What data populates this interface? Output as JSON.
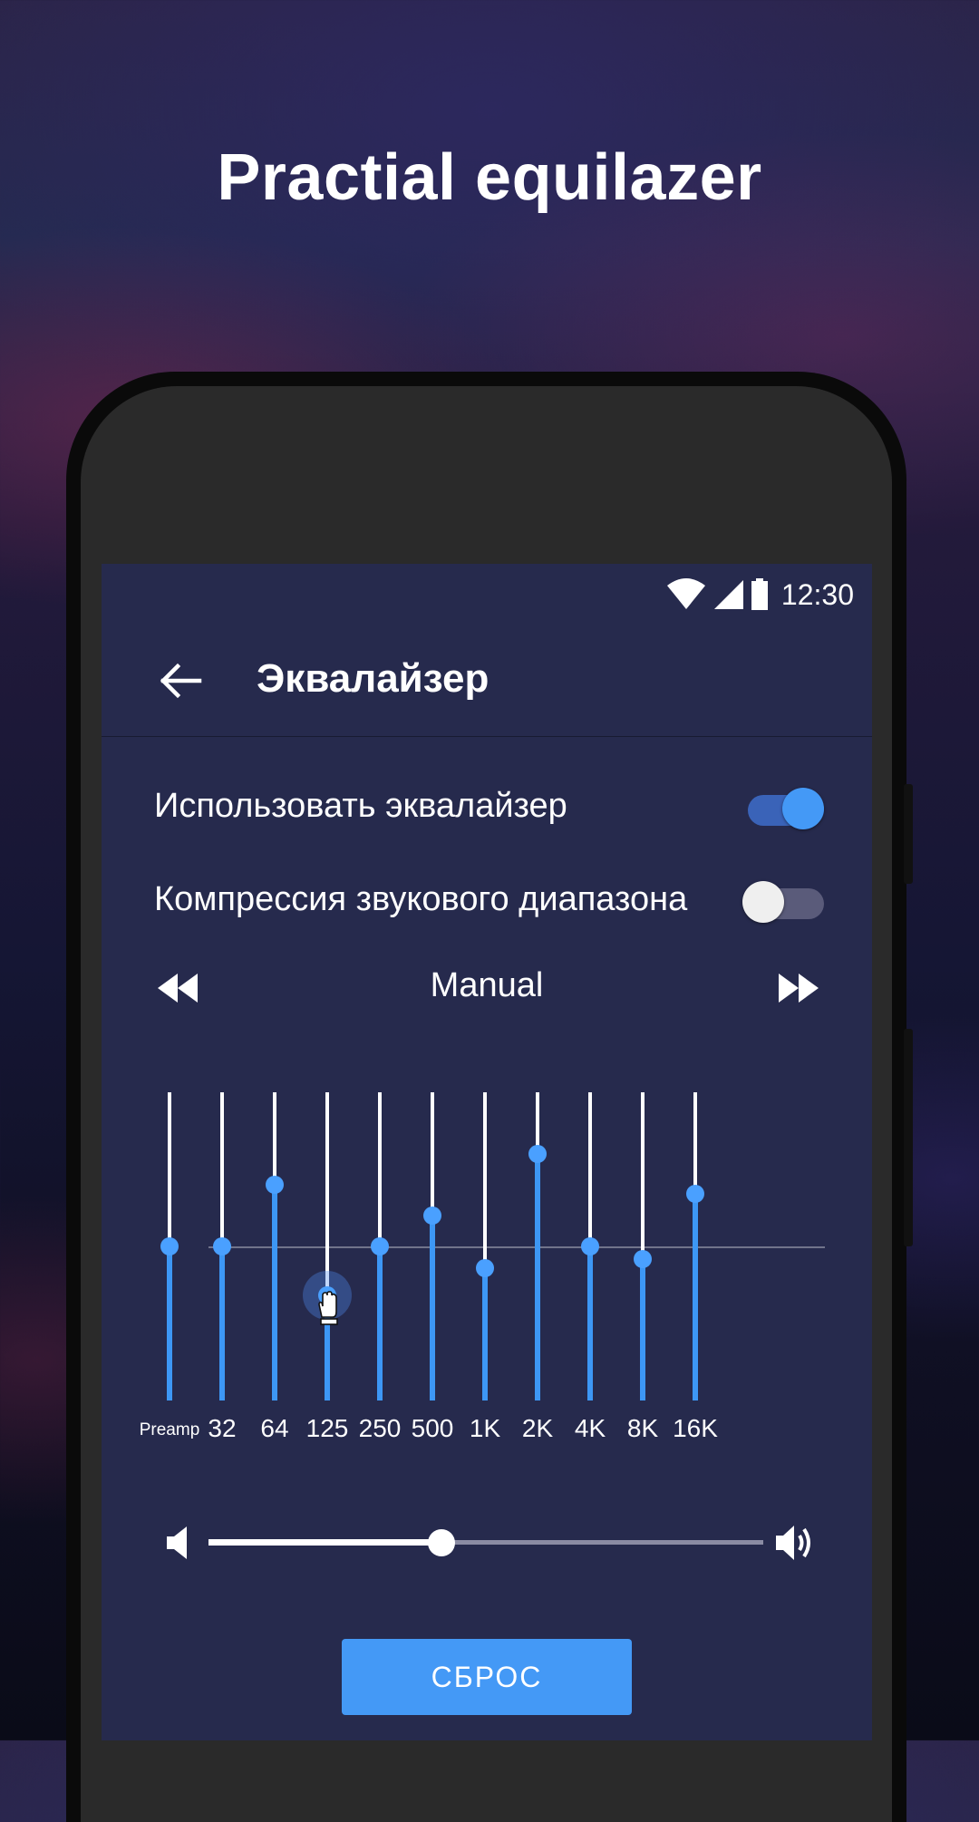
{
  "headline": "Practial equilazer",
  "status_bar": {
    "time": "12:30"
  },
  "app_bar": {
    "title": "Эквалайзер"
  },
  "settings": {
    "use_equalizer": {
      "label": "Использовать эквалайзер",
      "on": true
    },
    "compression": {
      "label": "Компрессия звукового диапазона",
      "on": false
    }
  },
  "preset": {
    "name": "Manual"
  },
  "equalizer": {
    "bands": [
      {
        "label": "Preamp",
        "level": 0.5
      },
      {
        "label": "32",
        "level": 0.5
      },
      {
        "label": "64",
        "level": 0.7
      },
      {
        "label": "125",
        "level": 0.34,
        "active": true
      },
      {
        "label": "250",
        "level": 0.5
      },
      {
        "label": "500",
        "level": 0.6
      },
      {
        "label": "1K",
        "level": 0.43
      },
      {
        "label": "2K",
        "level": 0.8
      },
      {
        "label": "4K",
        "level": 0.5
      },
      {
        "label": "8K",
        "level": 0.46
      },
      {
        "label": "16K",
        "level": 0.67
      }
    ]
  },
  "volume": {
    "level": 0.42
  },
  "reset_button": {
    "label": "СБРОС"
  },
  "colors": {
    "accent": "#4499f6",
    "screen_bg": "#262a4d",
    "toggle_on_track": "#3a63b8",
    "toggle_off_track": "#5a5b7a",
    "toggle_off_knob": "#efefef"
  }
}
